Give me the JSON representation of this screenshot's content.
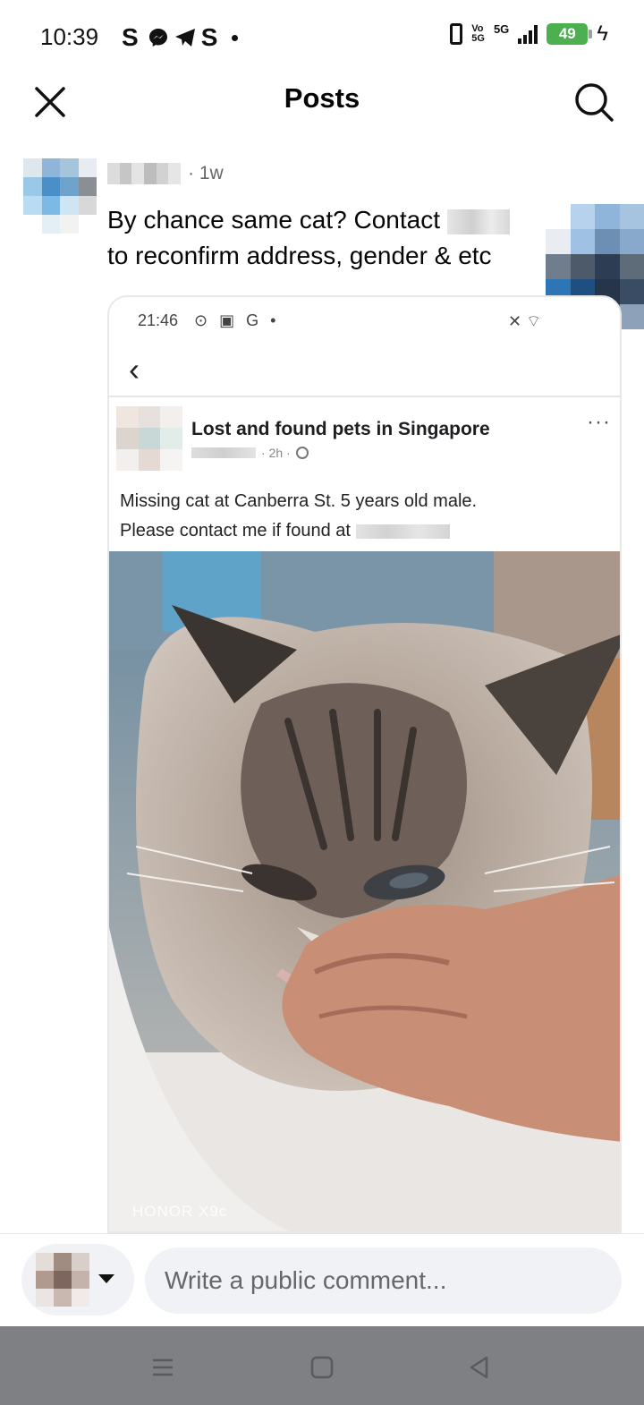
{
  "status_bar": {
    "time": "10:39",
    "app_icons": [
      "S",
      "messenger-icon",
      "telegram-icon",
      "S"
    ],
    "network": "5G",
    "volte": "Vo 5G",
    "battery": "49"
  },
  "header": {
    "title": "Posts",
    "close_icon": "close-icon",
    "search_icon": "search-icon"
  },
  "post": {
    "time": "· 1w",
    "text_line1_prefix": "By chance same cat? Contact",
    "text_line2": "to reconfirm address, gender & etc"
  },
  "screenshot": {
    "time": "21:46",
    "status_icons": "⊙ ▣ G •",
    "status_right": "✕ ⌔",
    "group_name": "Lost and found pets in Singapore",
    "post_age": "· 2h ·",
    "more": "···",
    "text_line1": "Missing cat at Canberra St. 5 years old male.",
    "text_line2": "Please contact me if found at",
    "watermark": "HONOR X9c"
  },
  "comment": {
    "placeholder": "Write a public comment..."
  },
  "colors": {
    "accent": "#1877f2",
    "battery": "#4caf50",
    "nav_bar": "#7f8083"
  }
}
